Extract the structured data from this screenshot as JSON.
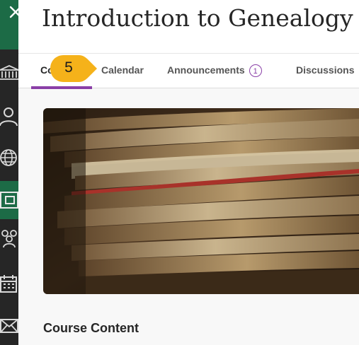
{
  "course": {
    "title": "Introduction to Genealogy"
  },
  "tabs": [
    {
      "label": "Co",
      "active": true
    },
    {
      "label": "Calendar"
    },
    {
      "label": "Announcements",
      "badge": "1"
    },
    {
      "label": "Discussions"
    }
  ],
  "callout": {
    "number": "5",
    "color": "#f5b21a"
  },
  "sidebar": {
    "icons": [
      "close-icon",
      "institution-icon",
      "user-icon",
      "globe-icon",
      "courses-icon",
      "groups-icon",
      "calendar-icon",
      "messages-icon"
    ],
    "accent": "#1c6b46"
  },
  "main": {
    "section_heading": "Course Content"
  },
  "colors": {
    "tab_underline": "#8a3fa7",
    "badge": "#8a3fa7"
  }
}
